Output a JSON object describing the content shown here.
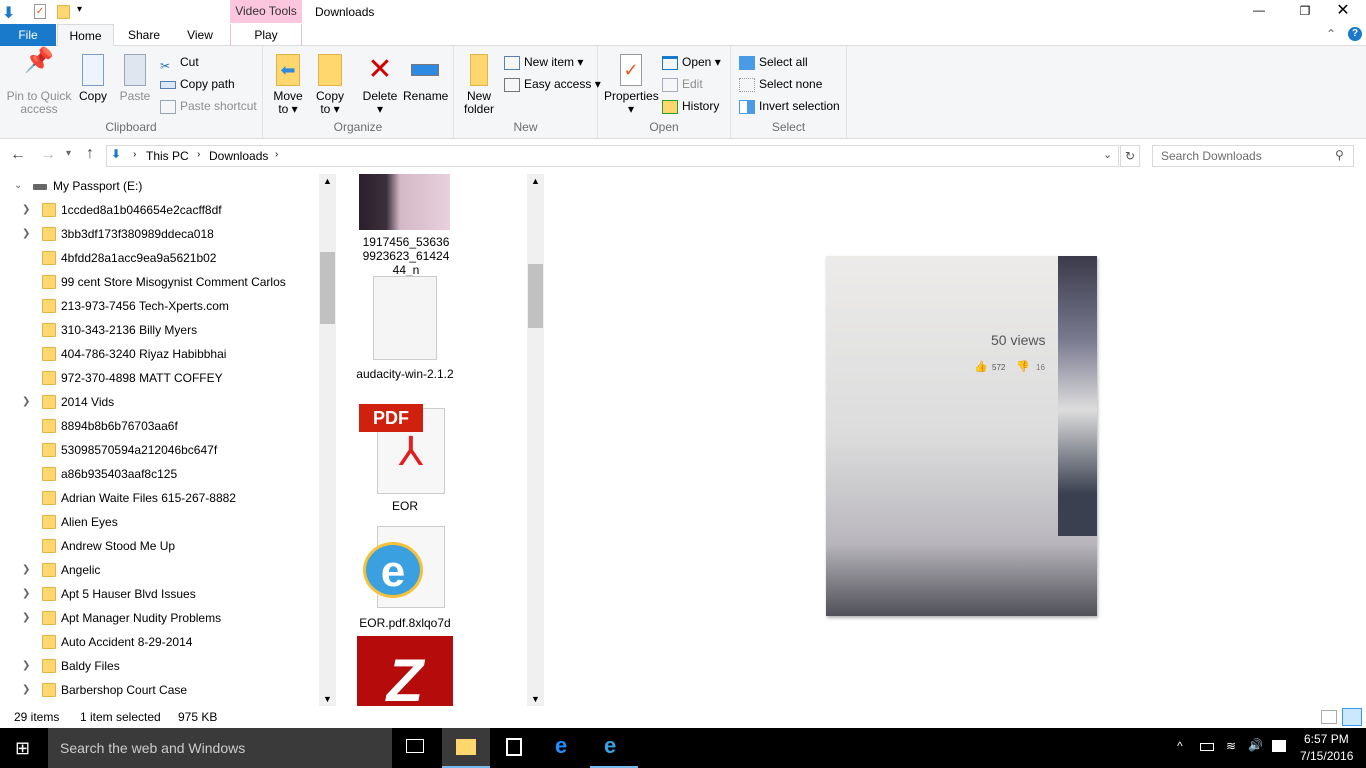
{
  "window": {
    "title": "Downloads",
    "contextual_tab_group": "Video Tools"
  },
  "tabs": {
    "file": "File",
    "home": "Home",
    "share": "Share",
    "view": "View",
    "play": "Play"
  },
  "ribbon": {
    "clipboard": {
      "label": "Clipboard",
      "pin": "Pin to Quick access",
      "copy": "Copy",
      "paste": "Paste",
      "cut": "Cut",
      "copy_path": "Copy path",
      "paste_shortcut": "Paste shortcut"
    },
    "organize": {
      "label": "Organize",
      "move_to": "Move to",
      "copy_to": "Copy to",
      "delete": "Delete",
      "rename": "Rename"
    },
    "new": {
      "label": "New",
      "new_folder": "New folder",
      "new_item": "New item",
      "easy_access": "Easy access"
    },
    "open": {
      "label": "Open",
      "properties": "Properties",
      "open": "Open",
      "edit": "Edit",
      "history": "History"
    },
    "select": {
      "label": "Select",
      "select_all": "Select all",
      "select_none": "Select none",
      "invert": "Invert selection"
    }
  },
  "address": {
    "crumbs": [
      "This PC",
      "Downloads"
    ],
    "search_placeholder": "Search Downloads"
  },
  "nav": {
    "root": "My Passport (E:)",
    "items": [
      {
        "label": "1ccded8a1b046654e2cacff8df",
        "expandable": true
      },
      {
        "label": "3bb3df173f380989ddeca018",
        "expandable": true
      },
      {
        "label": "4bfdd28a1acc9ea9a5621b02",
        "expandable": false
      },
      {
        "label": "99 cent Store Misogynist Comment Carlos",
        "expandable": false
      },
      {
        "label": "213-973-7456 Tech-Xperts.com",
        "expandable": false
      },
      {
        "label": "310-343-2136 Billy Myers",
        "expandable": false
      },
      {
        "label": "404-786-3240 Riyaz Habibbhai",
        "expandable": false
      },
      {
        "label": "972-370-4898 MATT COFFEY",
        "expandable": false
      },
      {
        "label": "2014 Vids",
        "expandable": true
      },
      {
        "label": "8894b8b6b76703aa6f",
        "expandable": false
      },
      {
        "label": "53098570594a212046bc647f",
        "expandable": false
      },
      {
        "label": "a86b935403aaf8c125",
        "expandable": false
      },
      {
        "label": "Adrian Waite Files 615-267-8882",
        "expandable": false
      },
      {
        "label": "Alien Eyes",
        "expandable": false
      },
      {
        "label": "Andrew Stood Me Up",
        "expandable": false
      },
      {
        "label": "Angelic",
        "expandable": true
      },
      {
        "label": "Apt 5 Hauser Blvd Issues",
        "expandable": true
      },
      {
        "label": "Apt Manager Nudity Problems",
        "expandable": true
      },
      {
        "label": "Auto Accident 8-29-2014",
        "expandable": false
      },
      {
        "label": "Baldy Files",
        "expandable": true
      },
      {
        "label": "Barbershop Court Case",
        "expandable": true
      }
    ]
  },
  "files": [
    {
      "name": "1917456_536369923623_6142444_n",
      "icon": "photo-thumbnail"
    },
    {
      "name": "audacity-win-2.1.2",
      "icon": "blank-file-icon"
    },
    {
      "name": "EOR",
      "icon": "pdf-icon",
      "badge": "PDF"
    },
    {
      "name": "EOR.pdf.8xlqo7d",
      "icon": "ie-file-icon"
    },
    {
      "name": "",
      "icon": "filezilla-icon"
    }
  ],
  "preview": {
    "views": "50 views",
    "likes": "572",
    "dislikes": "16"
  },
  "status": {
    "count": "29 items",
    "selected": "1 item selected",
    "size": "975 KB"
  },
  "taskbar": {
    "search": "Search the web and Windows",
    "time": "6:57 PM",
    "date": "7/15/2016"
  },
  "colors": {
    "file_tab": "#1979ca",
    "video_tools": "#fbc6de",
    "accent": "#0078d7"
  }
}
